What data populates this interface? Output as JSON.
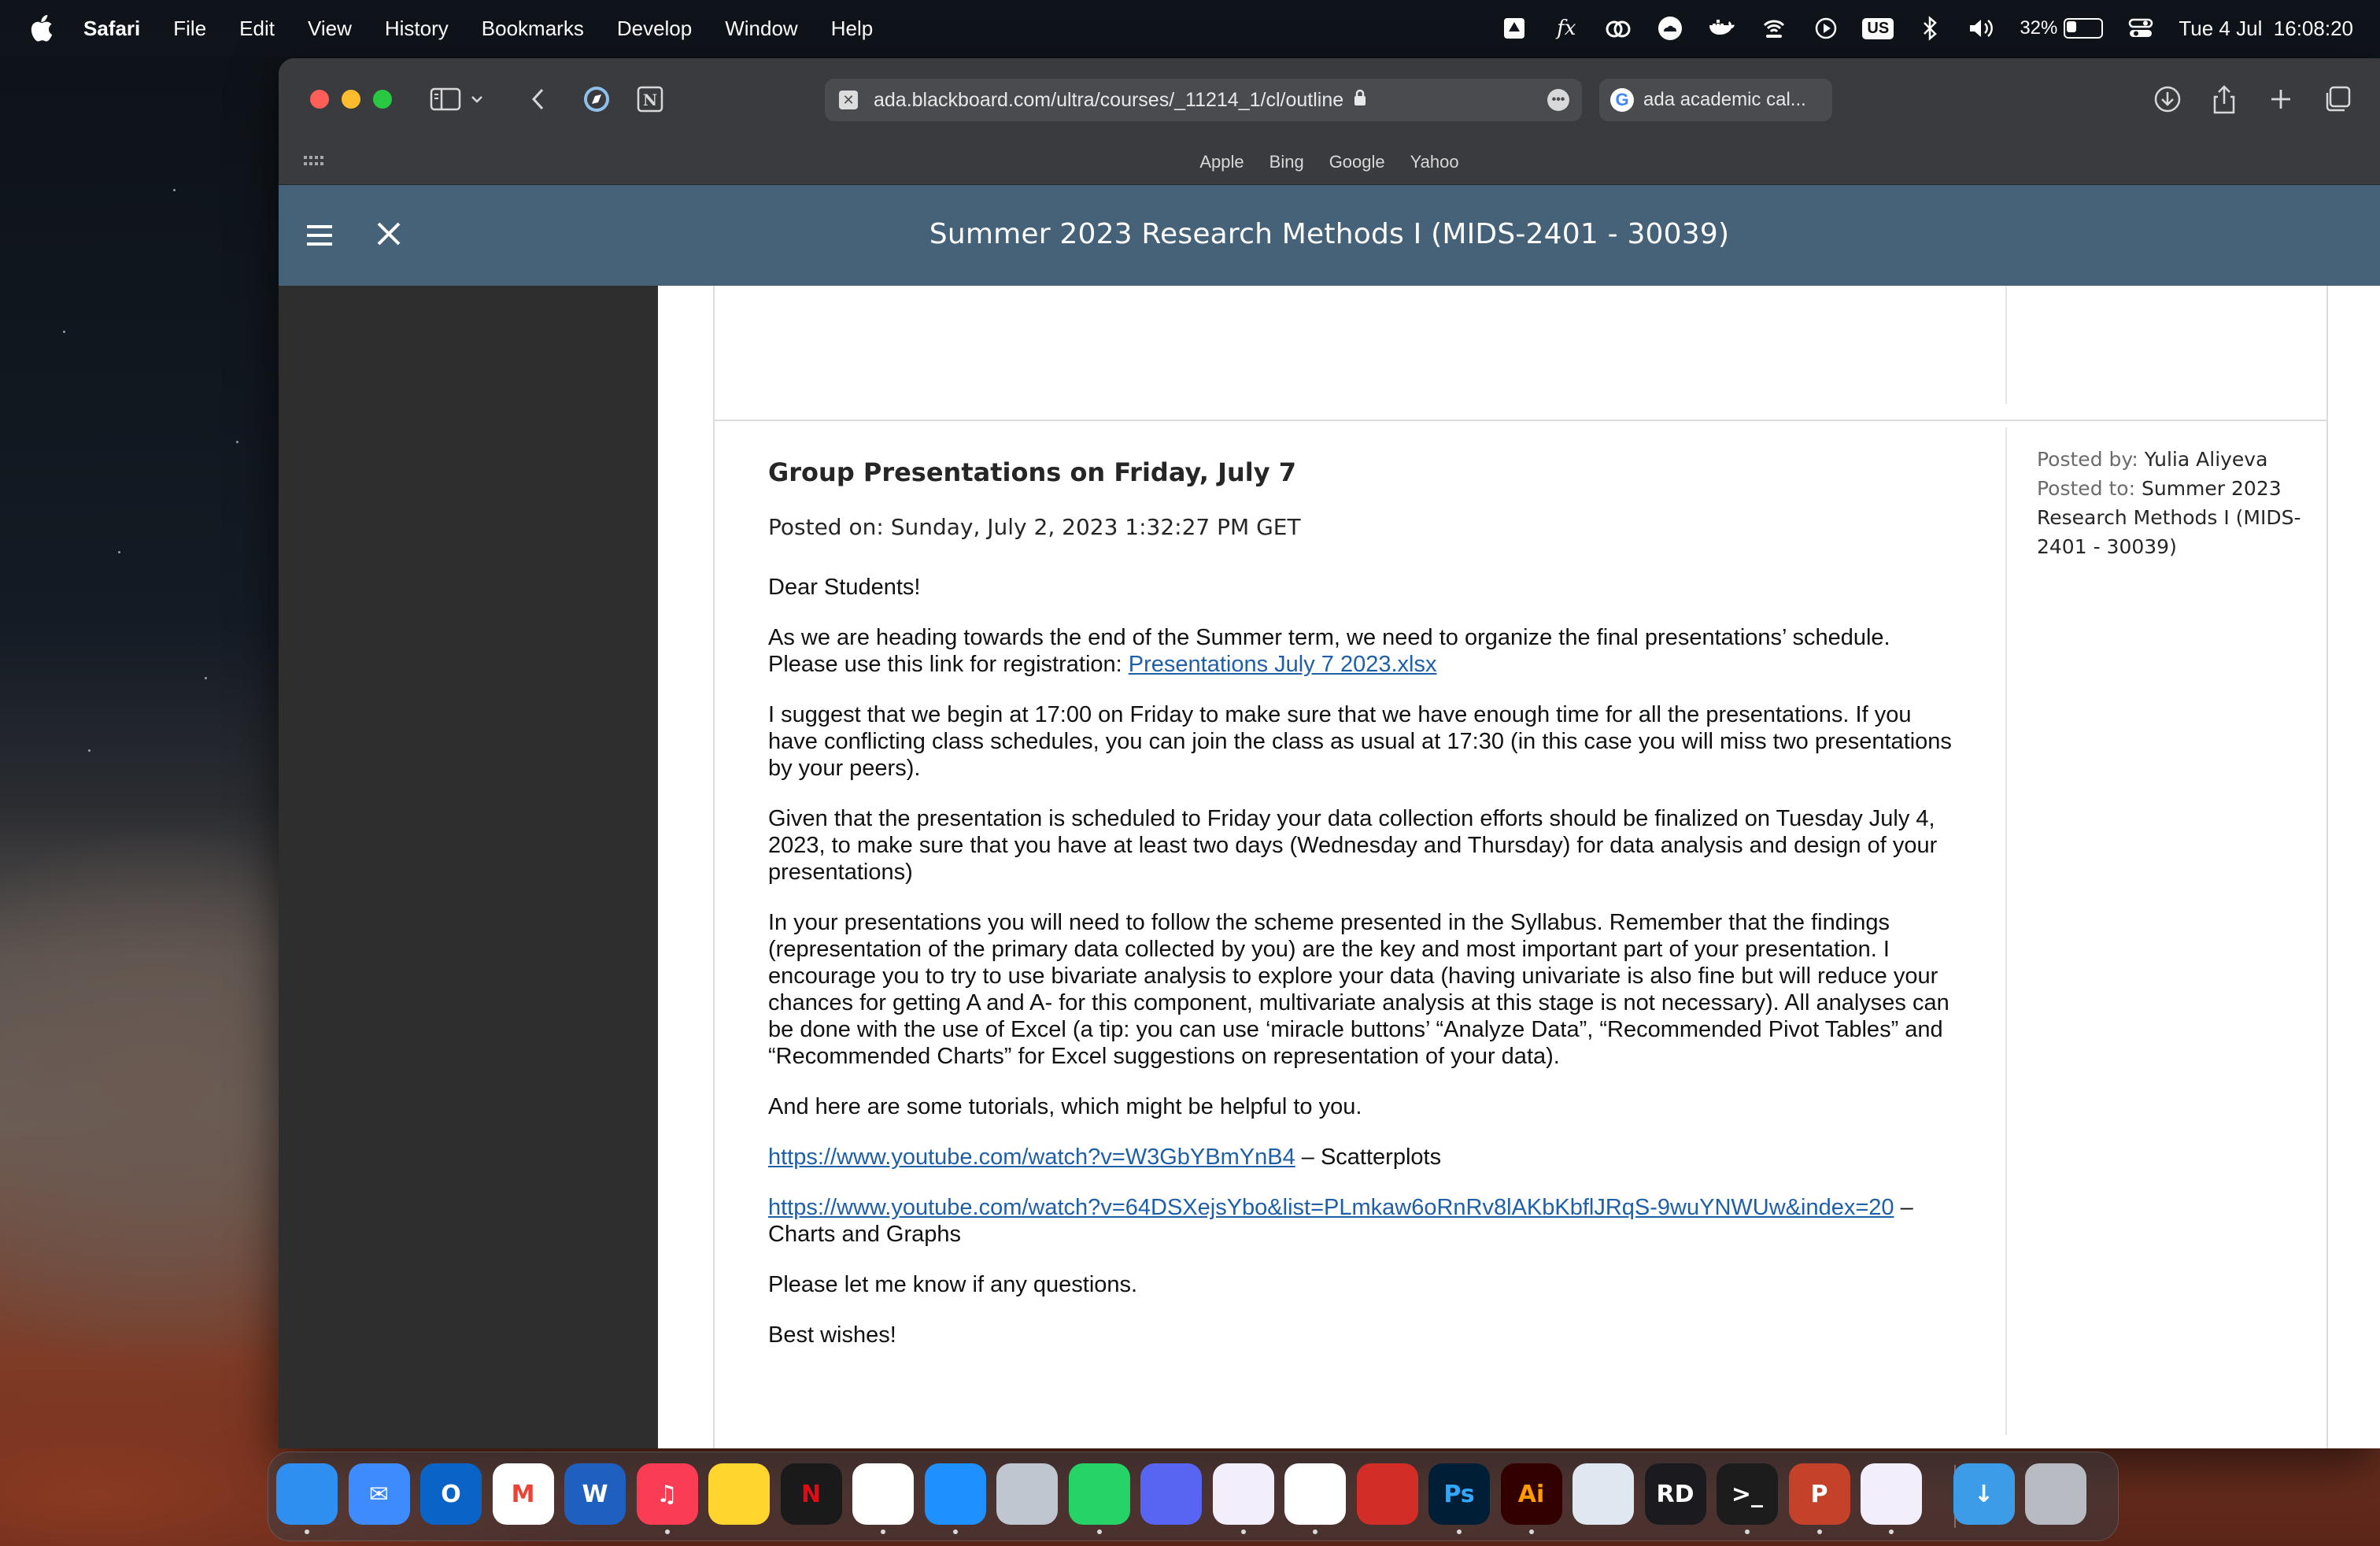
{
  "menubar": {
    "app_name": "Safari",
    "items": [
      "File",
      "Edit",
      "View",
      "History",
      "Bookmarks",
      "Develop",
      "Window",
      "Help"
    ],
    "input_source": "US",
    "battery_percent": "32%",
    "battery_level": 0.32,
    "clock": "Tue 4 Jul  16:08:20"
  },
  "browser": {
    "url": "ada.blackboard.com/ultra/courses/_11214_1/cl/outline",
    "other_tab_title": "ada academic cal...",
    "favorites": [
      "Apple",
      "Bing",
      "Google",
      "Yahoo"
    ]
  },
  "course": {
    "title": "Summer 2023 Research Methods I (MIDS-2401 - 30039)"
  },
  "announcement": {
    "title": "Group Presentations on Friday, July 7",
    "posted_on": "Posted on: Sunday, July 2, 2023 1:32:27 PM GET",
    "greeting": "Dear Students!",
    "p1": "As we are heading towards the end of the Summer term, we need to organize the final presentations’ schedule. Please use this link for registration: ",
    "p1_link": "Presentations July 7 2023.xlsx",
    "p2": "I suggest that we begin at 17:00 on Friday to make sure that we have enough time for all the presentations. If you have conflicting class schedules, you can join the class as usual at 17:30 (in this case you will miss two presentations by your peers).",
    "p3": "Given that the presentation is scheduled to Friday your data collection efforts should be finalized on Tuesday July 4, 2023, to make sure that you have at least two days (Wednesday and Thursday) for data analysis and design of your presentations)",
    "p4": "In your presentations you will need to follow the scheme presented in the Syllabus. Remember that the findings (representation of the primary data collected by you) are the key and most important part of your presentation. I encourage you to try to use bivariate analysis to explore your data (having univariate is also fine but will reduce your chances for getting A and A- for this component, multivariate analysis at this stage is not necessary). All analyses can be done with the use of Excel (a tip: you can use ‘miracle buttons’ “Analyze Data”, “Recommended Pivot Tables” and “Recommended Charts” for Excel suggestions on representation of your data).",
    "p5": "And here are some tutorials, which might be helpful to you.",
    "link1": "https://www.youtube.com/watch?v=W3GbYBmYnB4",
    "link1_suffix": " – Scatterplots",
    "link2": "https://www.youtube.com/watch?v=64DSXejsYbo&list=PLmkaw6oRnRv8lAKbKbflJRqS-9wuYNWUw&index=20",
    "link2_suffix": " – Charts and Graphs",
    "p6": "Please let me know if any questions.",
    "closing": "Best wishes!",
    "posted_by_label": "Posted by:",
    "posted_by": "Yulia Aliyeva",
    "posted_to_label": "Posted to:",
    "posted_to": "Summer 2023 Research Methods I (MIDS-2401 - 30039)"
  },
  "dock": {
    "apps": [
      {
        "name": "Finder",
        "label": "",
        "color": "#2f8ff0",
        "running": true
      },
      {
        "name": "Mail",
        "label": "✉",
        "color": "#3d8bfd",
        "running": false
      },
      {
        "name": "Outlook",
        "label": "O",
        "color": "#0a64c8",
        "running": false
      },
      {
        "name": "Gmail",
        "label": "M",
        "color": "#ffffff",
        "running": false
      },
      {
        "name": "Word",
        "label": "W",
        "color": "#1e5fbf",
        "running": false
      },
      {
        "name": "Music",
        "label": "♫",
        "color": "#fa3c55",
        "running": true
      },
      {
        "name": "Notes",
        "label": "",
        "color": "#ffd52e",
        "running": false
      },
      {
        "name": "Netflix",
        "label": "N",
        "color": "#1a1a1a",
        "running": false
      },
      {
        "name": "Chrome",
        "label": "",
        "color": "#ffffff",
        "running": true
      },
      {
        "name": "Safari",
        "label": "",
        "color": "#1e90ff",
        "running": true
      },
      {
        "name": "Launchpad",
        "label": "",
        "color": "#c0c6cf",
        "running": false
      },
      {
        "name": "WhatsApp",
        "label": "",
        "color": "#25d366",
        "running": true
      },
      {
        "name": "Discord",
        "label": "",
        "color": "#5865f2",
        "running": false
      },
      {
        "name": "Visual Studio",
        "label": "",
        "color": "#f3eefc",
        "running": true
      },
      {
        "name": "VS Code",
        "label": "",
        "color": "#ffffff",
        "running": true
      },
      {
        "name": "Acrobat",
        "label": "",
        "color": "#d32d27",
        "running": false
      },
      {
        "name": "Photoshop",
        "label": "Ps",
        "color": "#001e36",
        "running": true
      },
      {
        "name": "Illustrator",
        "label": "Ai",
        "color": "#330000",
        "running": true
      },
      {
        "name": "Network Radar",
        "label": "",
        "color": "#dfe7f1",
        "running": false
      },
      {
        "name": "Rider",
        "label": "RD",
        "color": "#1b1b1f",
        "running": false
      },
      {
        "name": "Terminal",
        "label": ">_",
        "color": "#1c1c1c",
        "running": true
      },
      {
        "name": "PowerPoint",
        "label": "P",
        "color": "#c4412a",
        "running": true
      },
      {
        "name": "Visual Studio 2",
        "label": "",
        "color": "#f3eefc",
        "running": true
      },
      {
        "name": "Downloads",
        "label": "↓",
        "color": "#3d9ce8",
        "running": false
      },
      {
        "name": "Trash",
        "label": "",
        "color": "#b8bcc2",
        "running": false
      }
    ]
  }
}
